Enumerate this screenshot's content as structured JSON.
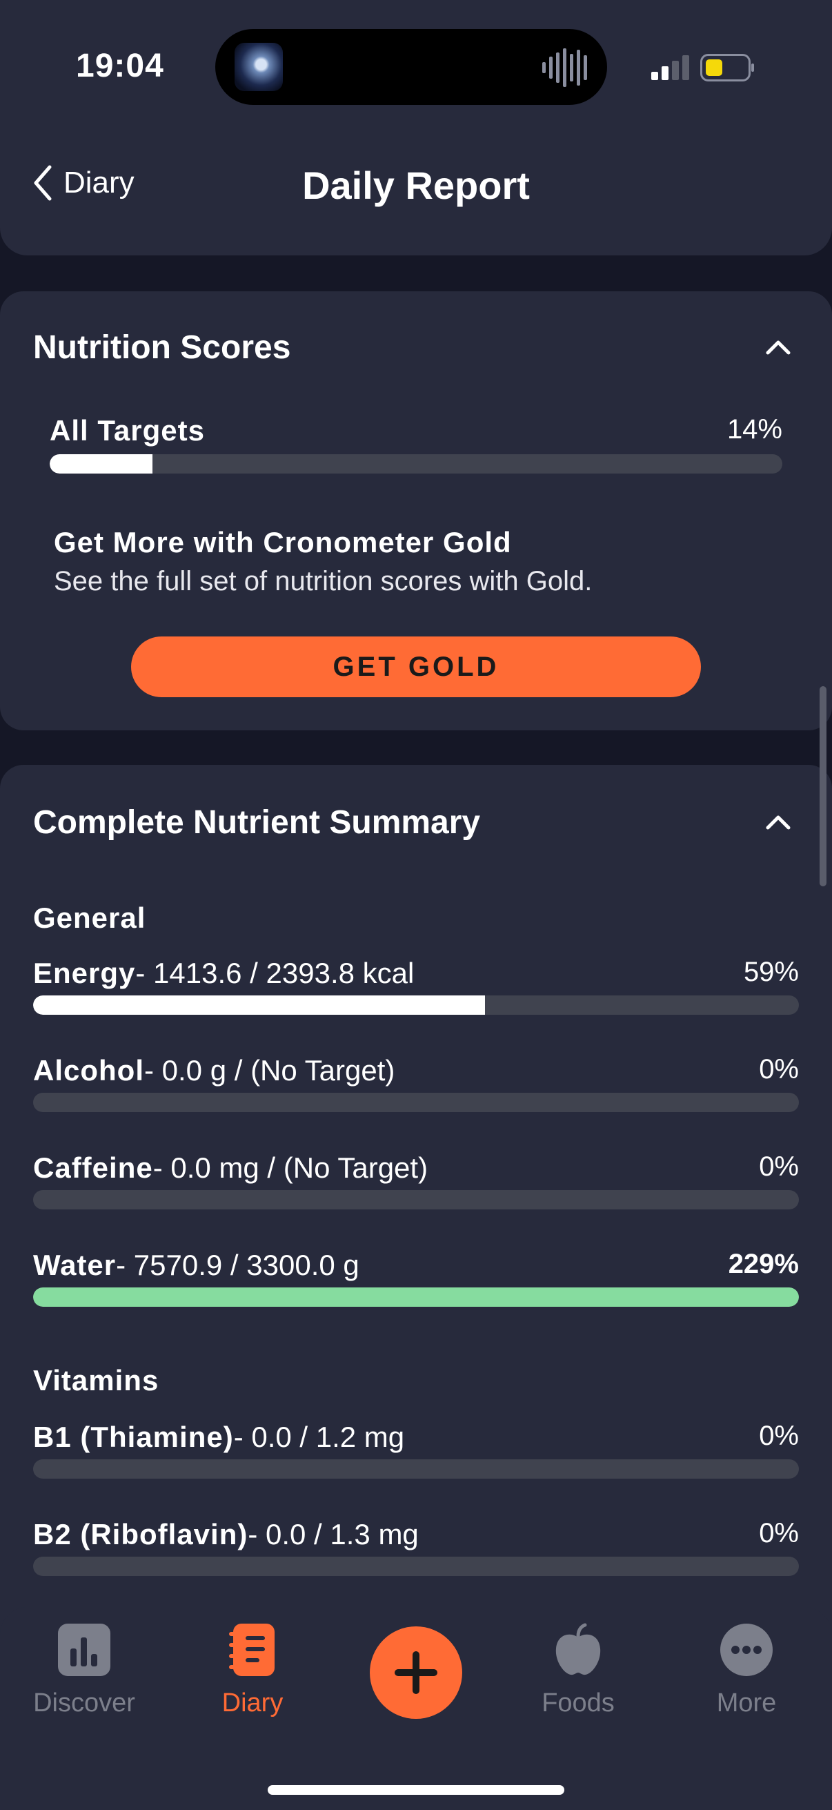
{
  "status": {
    "time": "19:04"
  },
  "header": {
    "back_label": "Diary",
    "title": "Daily Report"
  },
  "nutrition_scores": {
    "title": "Nutrition Scores",
    "all_targets": {
      "label": "All Targets",
      "percent_text": "14%",
      "percent": 0.14
    },
    "promo": {
      "title": "Get More with Cronometer Gold",
      "text": "See the full set of nutrition scores with Gold.",
      "button_label": "GET GOLD"
    }
  },
  "summary": {
    "title": "Complete Nutrient Summary",
    "general": {
      "heading": "General",
      "rows": [
        {
          "name": "Energy",
          "detail": "- 1413.6 / 2393.8 kcal",
          "percent_text": "59%",
          "percent": 0.59
        },
        {
          "name": "Alcohol",
          "detail": "- 0.0 g / (No Target)",
          "percent_text": "0%",
          "percent": 0
        },
        {
          "name": "Caffeine",
          "detail": "- 0.0 mg / (No Target)",
          "percent_text": "0%",
          "percent": 0
        },
        {
          "name": "Water",
          "detail": "- 7570.9 / 3300.0 g",
          "percent_text": "229%",
          "percent": 2.29
        }
      ]
    },
    "vitamins": {
      "heading": "Vitamins",
      "rows": [
        {
          "name": "B1 (Thiamine)",
          "detail": "- 0.0 / 1.2 mg",
          "percent_text": "0%",
          "percent": 0
        },
        {
          "name": "B2 (Riboflavin)",
          "detail": "- 0.0 / 1.3 mg",
          "percent_text": "0%",
          "percent": 0
        }
      ]
    }
  },
  "tabbar": {
    "items": [
      {
        "label": "Discover",
        "icon": "discover-chart-icon"
      },
      {
        "label": "Diary",
        "icon": "diary-notebook-icon"
      },
      {
        "label": "Foods",
        "icon": "apple-icon"
      },
      {
        "label": "More",
        "icon": "more-dots-icon"
      }
    ],
    "active": "Diary"
  },
  "colors": {
    "accent": "#ff6b35",
    "over_target": "#86dc9f",
    "card": "#272a3c",
    "background": "#151726"
  }
}
